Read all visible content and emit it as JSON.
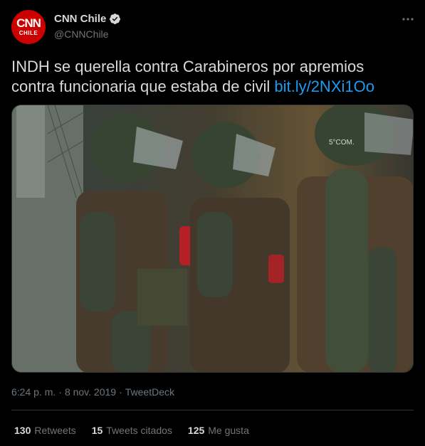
{
  "author": {
    "display_name": "CNN Chile",
    "handle": "@CNNChile",
    "avatar_top": "CNN",
    "avatar_bottom": "CHILE",
    "verified": true
  },
  "tweet": {
    "text": "INDH se querella contra Carabineros por apremios contra funcionaria que estaba de civil ",
    "link": "bit.ly/2NXi1Oo"
  },
  "media": {
    "description_icon": "photo",
    "helmet_text": "5°COM."
  },
  "meta": {
    "time": "6:24 p. m.",
    "separator": "·",
    "date": "8 nov. 2019",
    "source": "TweetDeck"
  },
  "stats": [
    {
      "count": "130",
      "label": "Retweets"
    },
    {
      "count": "15",
      "label": "Tweets citados"
    },
    {
      "count": "125",
      "label": "Me gusta"
    }
  ],
  "colors": {
    "background": "#000000",
    "link": "#1d9bf0",
    "muted": "#6e767d",
    "brand": "#cc0000"
  }
}
